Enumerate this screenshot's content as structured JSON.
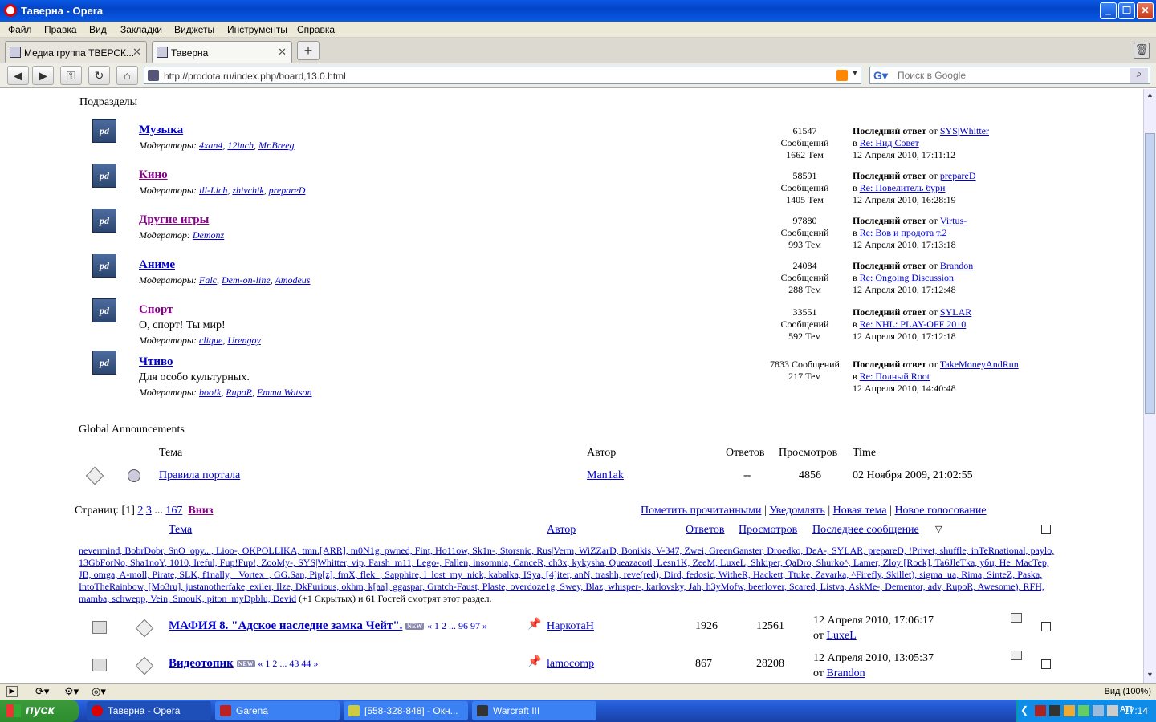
{
  "window": {
    "title": "Таверна - Opera"
  },
  "menu": [
    "Файл",
    "Правка",
    "Вид",
    "Закладки",
    "Виджеты",
    "Инструменты",
    "Справка"
  ],
  "tabs": [
    {
      "label": "Медиа группа ТВЕРСК...",
      "active": false
    },
    {
      "label": "Таверна",
      "active": true
    }
  ],
  "address": {
    "url": "http://prodota.ru/index.php/board,13.0.html"
  },
  "search": {
    "placeholder": "Поиск в Google"
  },
  "subboards": {
    "title": "Подразделы",
    "items": [
      {
        "name": "Музыка",
        "desc": "",
        "mods_label": "Модераторы:",
        "mods": [
          "4xan4",
          "12inch",
          "Mr.Breeg"
        ],
        "posts": "61547",
        "posts_label": "Сообщений",
        "topics": "1662 Тем",
        "last_label": "Последний ответ",
        "by": "от",
        "last_user": "SYS|Whitter",
        "in": "в",
        "last_topic": "Re: Нид Совет",
        "last_time": "12 Апреля 2010, 17:11:12"
      },
      {
        "name": "Кино",
        "desc": "",
        "mods_label": "Модераторы:",
        "mods": [
          "ill-Lich",
          "zhivchik",
          "prepareD"
        ],
        "posts": "58591",
        "posts_label": "Сообщений",
        "topics": "1405 Тем",
        "last_label": "Последний ответ",
        "by": "от",
        "last_user": "prepareD",
        "in": "в",
        "last_topic": "Re: Повелитель бури",
        "last_time": "12 Апреля 2010, 16:28:19"
      },
      {
        "name": "Другие игры",
        "desc": "",
        "mods_label": "Модератор:",
        "mods": [
          "Demonz"
        ],
        "posts": "97880",
        "posts_label": "Сообщений",
        "topics": "993 Тем",
        "last_label": "Последний ответ",
        "by": "от",
        "last_user": "Virtus-",
        "in": "в",
        "last_topic": "Re: Вов и продота т.2",
        "last_time": "12 Апреля 2010, 17:13:18"
      },
      {
        "name": "Аниме",
        "desc": "",
        "mods_label": "Модераторы:",
        "mods": [
          "Falc",
          "Dem-on-line",
          "Amodeus"
        ],
        "posts": "24084",
        "posts_label": "Сообщений",
        "topics": "288 Тем",
        "last_label": "Последний ответ",
        "by": "от",
        "last_user": "Brandon",
        "in": "в",
        "last_topic": "Re: Ongoing Discussion",
        "last_time": "12 Апреля 2010, 17:12:48"
      },
      {
        "name": "Спорт",
        "desc": "О, спорт! Ты мир!",
        "mods_label": "Модераторы:",
        "mods": [
          "clique",
          "Urengoy"
        ],
        "posts": "33551",
        "posts_label": "Сообщений",
        "topics": "592 Тем",
        "last_label": "Последний ответ",
        "by": "от",
        "last_user": "SYLAR",
        "in": "в",
        "last_topic": "Re: NHL: PLAY-OFF 2010",
        "last_time": "12 Апреля 2010, 17:12:18"
      },
      {
        "name": "Чтиво",
        "desc": "Для особо культурных.",
        "mods_label": "Модераторы:",
        "mods": [
          "boo!k",
          "RupoR",
          "Emma Watson"
        ],
        "posts": "7833 Сообщений",
        "posts_label": "",
        "topics": "217 Тем",
        "last_label": "Последний ответ",
        "by": "от",
        "last_user": "TakeMoneyAndRun",
        "in": "в",
        "last_topic": "Re: Полный Root",
        "last_time": "12 Апреля 2010, 14:40:48"
      }
    ]
  },
  "announcements": {
    "title": "Global Announcements",
    "headers": {
      "topic": "Тема",
      "author": "Автор",
      "replies": "Ответов",
      "views": "Просмотров",
      "time": "Time"
    },
    "row": {
      "topic": "Правила портала",
      "author": "Man1ak",
      "replies": "--",
      "views": "4856",
      "time": "02 Ноября 2009, 21:02:55"
    }
  },
  "pager": {
    "label": "Страниц:",
    "current": "[1]",
    "pages": [
      "2",
      "3"
    ],
    "ellipsis": "...",
    "last": "167",
    "down": "Вниз"
  },
  "actions": [
    "Пометить прочитанными",
    "Уведомлять",
    "Новая тема",
    "Новое голосование"
  ],
  "topics_header": {
    "topic": "Тема",
    "author": "Автор",
    "replies": "Ответов",
    "views": "Просмотров",
    "last": "Последнее сообщение"
  },
  "online": {
    "users_text": "nevermind, BobrDobr, SnO_opy..., Lioo-, OKPOLLIKA, tmn.[ARR], m0N1g, pwned, Fint, Ho11ow, Sk1n-, Storsnic, Rus|Verm, WiZZarD, Bonikis, V-347, Zwei, GreenGanster, Droedko, DeA-, SYLAR, prepareD, !Privet, shuffle, inTeRnational, paylo, 13GbForNo, Sha1noY, 1010, Ireful, Fup!Fup!, ZooMy-, SYS|Whitter, vip, Farsh_m11, Lego-, Fallen, insomnia, CanceR, ch3x, kykysha, Queazacotl, Lesn1K, ZeeM, LuxeL, Shkiper, QaDro, Shurko^, Lamer, Zloy [Rock], Ta6JleTka, убц, He_MacTep, JB, omga, A-moll, Pirate, SLK, f1nally, _Vortex_, GG.San, Pip[z], fmX, flek_, Sapphire, l_lost_my_nick, kabalka, ISya, [4]iter, anN, trashh, reve(red), Dird, fedosic, WitheR, Hackett, Ttuke, Zavarka, ^Firefly, Skillet), sigma_ua, Rima, SinteZ, Paska, IntoTheRainbow, [Mo3ru], justanotherfake, exiler, Ilze, DkFurious, okhm, k[aa], ggaspar, Gratch-Faust, Plaste, overdoze1g, Swey, Blaz, whisper-, karlovsky, Jah, h3yMofw, beerlover, Scared, Listva, AskMe-, Dementor, adv, RupoR, Awesome), RFH, mamba, schwepp, Vein, SmouK, piton_myDpblu, Devid",
    "suffix": "(+1 Скрытых) и 61 Гостей смотрят этот раздел."
  },
  "topics": [
    {
      "title": "МАФИЯ 8. \"Адское наследие замка Чейт\".",
      "new": "NEW",
      "pages": "« 1 2 ... 96 97 »",
      "author": "НаркотаН",
      "replies": "1926",
      "views": "12561",
      "last_time": "12 Апреля 2010, 17:06:17",
      "last_by": "от",
      "last_user": "LuxeL"
    },
    {
      "title": "Видеотопик",
      "new": "NEW",
      "pages": "« 1 2 ... 43 44 »",
      "author": "lamocomp",
      "replies": "867",
      "views": "28208",
      "last_time": "12 Апреля 2010, 13:05:37",
      "last_by": "от",
      "last_user": "Brandon"
    }
  ],
  "statusbar": {
    "zoom": "Вид (100%)"
  },
  "taskbar": {
    "start": "пуск",
    "tasks": [
      "Таверна - Opera",
      "Garena",
      "[558-328-848] - Окн...",
      "Warcraft III"
    ],
    "clock": "17:14"
  },
  "colors": {
    "link": "#0000cc",
    "visited": "#880088",
    "taskbar": "#245edb"
  }
}
